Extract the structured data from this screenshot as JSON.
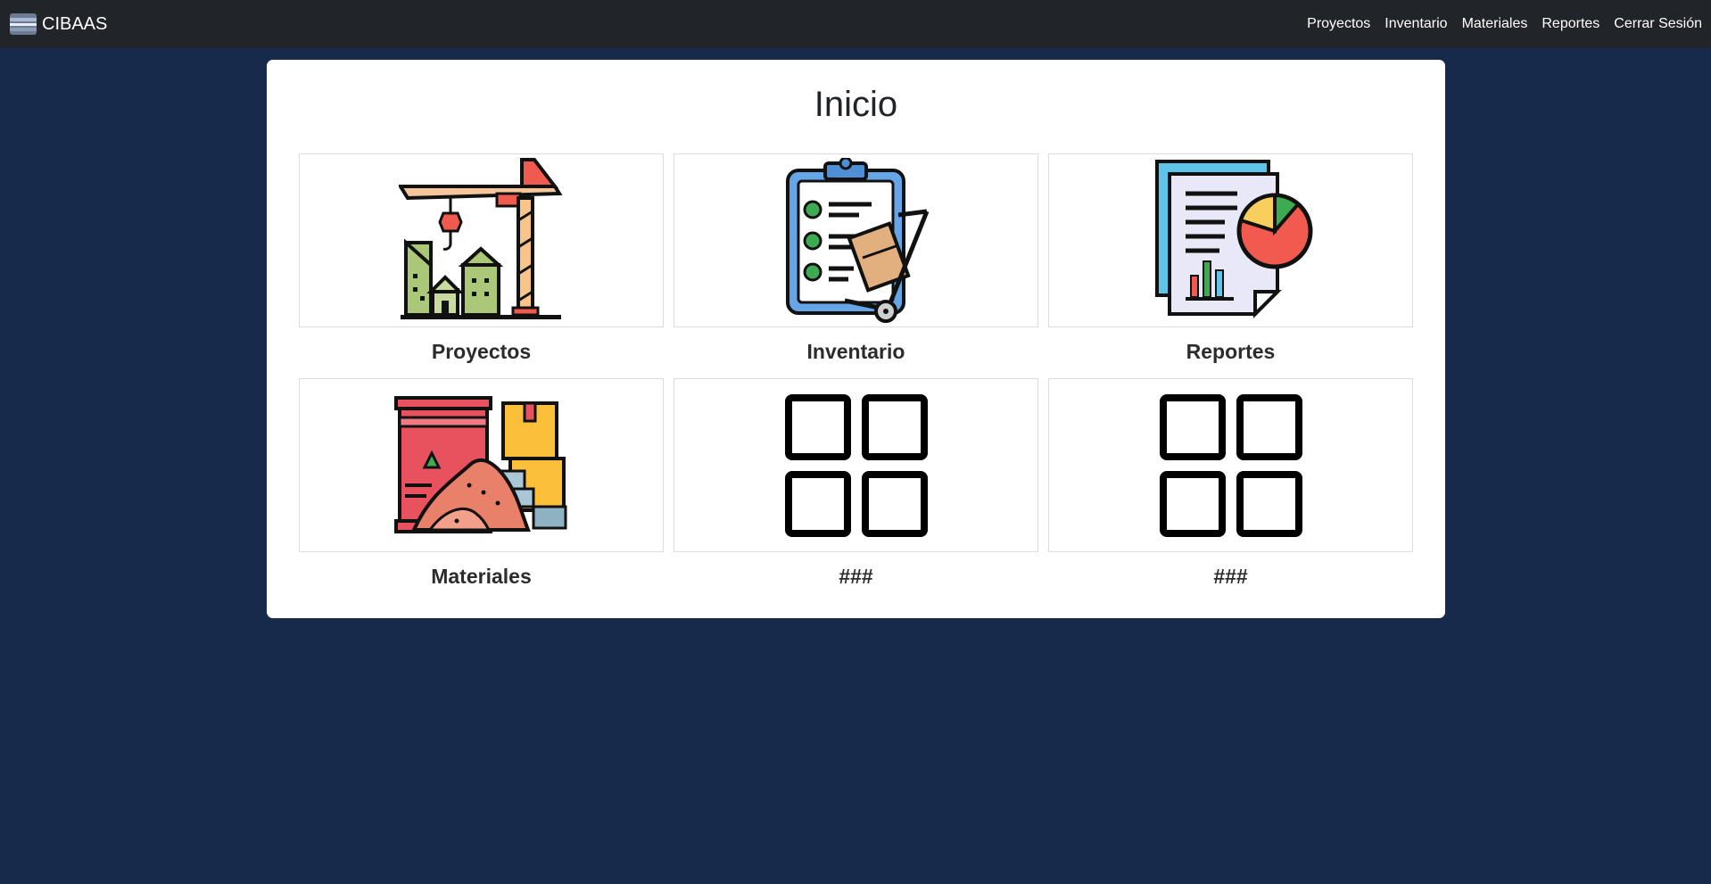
{
  "app": {
    "brand": "CIBAAS"
  },
  "nav": {
    "items": [
      "Proyectos",
      "Inventario",
      "Materiales",
      "Reportes",
      "Cerrar Sesión"
    ]
  },
  "main": {
    "title": "Inicio",
    "cards": [
      {
        "label": "Proyectos",
        "icon": "construction-crane-icon"
      },
      {
        "label": "Inventario",
        "icon": "inventory-clipboard-icon"
      },
      {
        "label": "Reportes",
        "icon": "report-chart-icon"
      },
      {
        "label": "Materiales",
        "icon": "materials-icon"
      },
      {
        "label": "###",
        "icon": "grid-icon"
      },
      {
        "label": "###",
        "icon": "grid-icon"
      }
    ]
  },
  "colors": {
    "navbar": "#212429",
    "background": "#172a4c",
    "panel": "#ffffff"
  }
}
